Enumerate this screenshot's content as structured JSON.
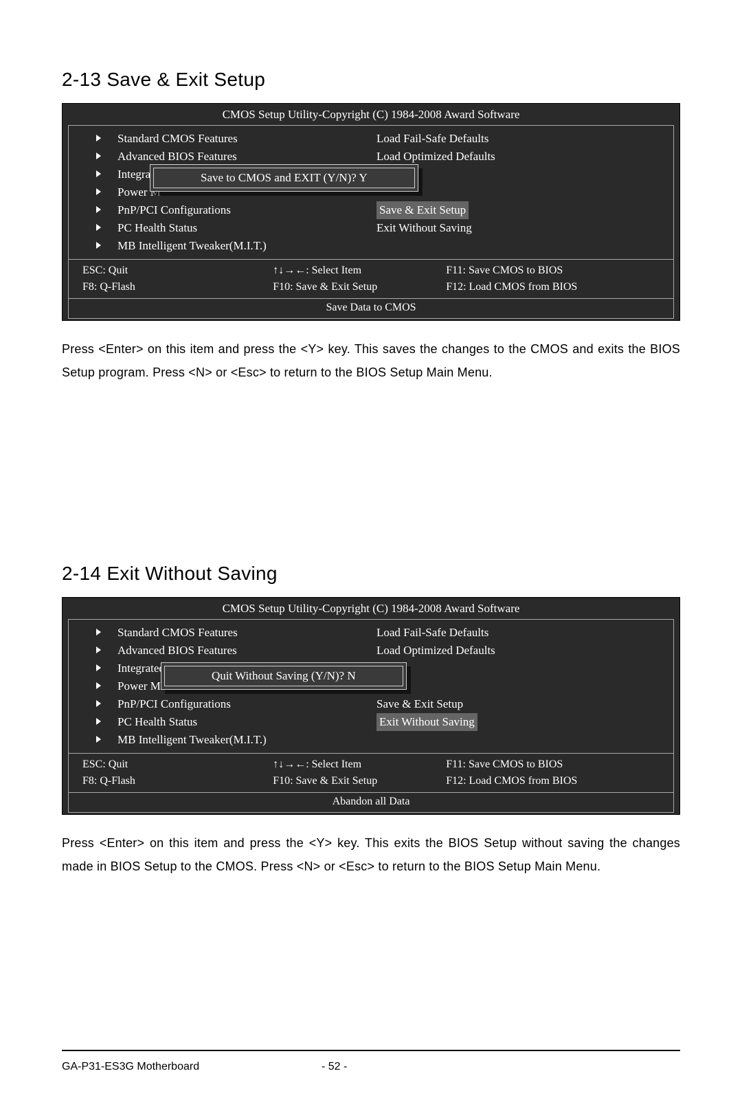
{
  "section1": {
    "title": "2-13  Save & Exit Setup",
    "bios": {
      "header": "CMOS Setup Utility-Copyright (C) 1984-2008 Award Software",
      "left": [
        "Standard CMOS Features",
        "Advanced BIOS Features",
        "Integrat",
        "Power M",
        "PnP/PCI Configurations",
        "PC Health Status",
        "MB Intelligent Tweaker(M.I.T.)"
      ],
      "right": [
        "Load Fail-Safe Defaults",
        "Load Optimized Defaults",
        "",
        "",
        "Save & Exit Setup",
        "Exit Without Saving",
        ""
      ],
      "highlight_index": 4,
      "keys": {
        "esc": "ESC: Quit",
        "arrows": "↑↓→←: Select Item",
        "f11": "F11: Save CMOS to BIOS",
        "f8": "F8: Q-Flash",
        "f10": "F10: Save & Exit Setup",
        "f12": "F12: Load CMOS from BIOS"
      },
      "helpbar": "Save Data to CMOS",
      "dialog": "Save to CMOS and EXIT (Y/N)? Y"
    },
    "text": "Press <Enter> on this item and press the <Y> key. This saves the changes to the CMOS and exits the BIOS Setup program. Press <N> or <Esc> to return to the BIOS Setup Main Menu."
  },
  "section2": {
    "title": "2-14  Exit Without Saving",
    "bios": {
      "header": "CMOS Setup Utility-Copyright (C) 1984-2008 Award Software",
      "left": [
        "Standard CMOS Features",
        "Advanced BIOS Features",
        "Integrated",
        "Power Ma",
        "PnP/PCI Configurations",
        "PC Health Status",
        "MB Intelligent Tweaker(M.I.T.)"
      ],
      "right": [
        "Load Fail-Safe Defaults",
        "Load Optimized Defaults",
        "",
        "",
        "Save & Exit Setup",
        "Exit Without Saving",
        ""
      ],
      "highlight_index": 5,
      "keys": {
        "esc": "ESC: Quit",
        "arrows": "↑↓→←: Select Item",
        "f11": "F11: Save CMOS to BIOS",
        "f8": "F8: Q-Flash",
        "f10": "F10: Save & Exit Setup",
        "f12": "F12: Load CMOS from BIOS"
      },
      "helpbar": "Abandon all Data",
      "dialog": "Quit Without Saving (Y/N)? N"
    },
    "text": "Press <Enter> on this item and press the <Y> key. This exits the BIOS Setup without saving the changes made in BIOS Setup to the CMOS. Press <N> or <Esc> to return to the BIOS Setup Main Menu."
  },
  "footer": {
    "product": "GA-P31-ES3G Motherboard",
    "page": "- 52 -"
  }
}
